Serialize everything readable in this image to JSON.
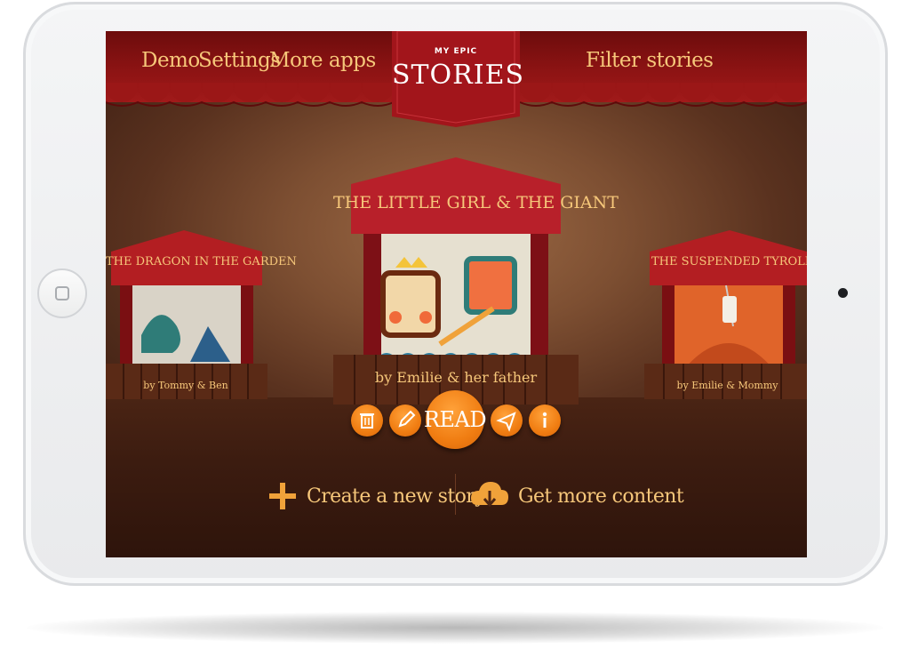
{
  "nav": {
    "demo": "Demo",
    "settings": "Settings",
    "more_apps": "More apps",
    "filter": "Filter stories"
  },
  "logo": {
    "small": "MY EPIC",
    "large": "STORIES"
  },
  "stories": [
    {
      "title": "THE DRAGON IN THE GARDEN",
      "author": "by Tommy & Ben"
    },
    {
      "title": "THE LITTLE GIRL & THE GIANT",
      "author": "by Emilie & her father"
    },
    {
      "title": "THE SUSPENDED TYROLEAN",
      "author": "by Emilie & Mommy"
    }
  ],
  "actions": {
    "read": "READ",
    "icons": [
      "trash-icon",
      "pencil-icon",
      "send-icon",
      "info-icon"
    ]
  },
  "bottom": {
    "create": "Create a new story",
    "get_more": "Get more content"
  },
  "colors": {
    "curtain": "#8f1414",
    "accent_text": "#f6c77a",
    "button": "#f07d12"
  }
}
